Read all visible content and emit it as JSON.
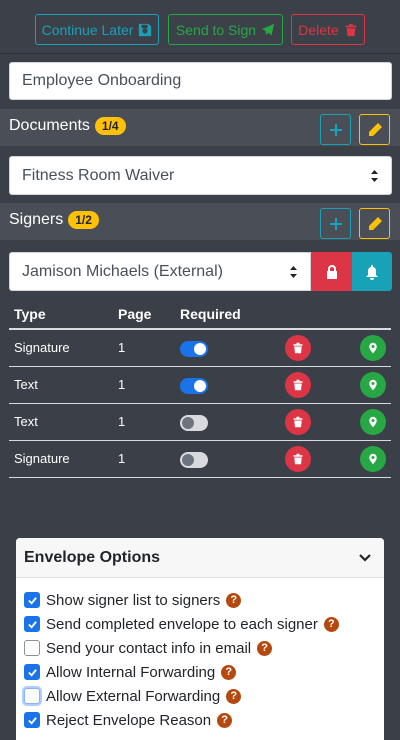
{
  "toolbar": {
    "continue_label": "Continue Later",
    "send_label": "Send to Sign",
    "delete_label": "Delete"
  },
  "envelope": {
    "title": "Employee Onboarding"
  },
  "documents": {
    "heading": "Documents",
    "badge": "1/4",
    "selected": "Fitness Room Waiver"
  },
  "signers": {
    "heading": "Signers",
    "badge": "1/2",
    "selected": "Jamison Michaels (External)"
  },
  "fields_table": {
    "headers": [
      "Type",
      "Page",
      "Required"
    ],
    "rows": [
      {
        "type": "Signature",
        "page": "1",
        "required": true
      },
      {
        "type": "Text",
        "page": "1",
        "required": true
      },
      {
        "type": "Text",
        "page": "1",
        "required": false
      },
      {
        "type": "Signature",
        "page": "1",
        "required": false
      }
    ]
  },
  "envelope_options": {
    "title": "Envelope Options",
    "options": [
      {
        "label": "Show signer list to signers",
        "checked": true
      },
      {
        "label": "Send completed envelope to each signer",
        "checked": true
      },
      {
        "label": "Send your contact info in email",
        "checked": false
      },
      {
        "label": "Allow Internal Forwarding",
        "checked": true
      },
      {
        "label": "Allow External Forwarding",
        "checked": false
      },
      {
        "label": "Reject Envelope Reason",
        "checked": true
      }
    ]
  },
  "icons": {
    "save": "floppy-disk-icon",
    "send": "paper-plane-icon",
    "trash": "trash-icon",
    "add": "plus-icon",
    "edit": "pencil-icon",
    "lock": "lock-icon",
    "bell": "bell-icon",
    "location": "map-marker-icon",
    "help": "question-circle-icon",
    "chevron": "chevron-down-icon"
  },
  "colors": {
    "info": "#17a2b8",
    "success": "#28a745",
    "danger": "#dc3545",
    "warning": "#ffc107",
    "primary": "#1a73e8"
  }
}
